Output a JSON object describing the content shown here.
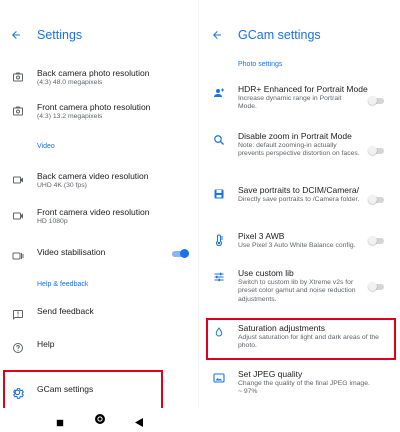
{
  "left": {
    "title": "Settings",
    "items": [
      {
        "label": "Back camera photo resolution",
        "sub": "(4:3) 48.0 megapixels",
        "icon": "photo-resolution-icon"
      },
      {
        "label": "Front camera photo resolution",
        "sub": "(4:3) 13.2 megapixels",
        "icon": "photo-resolution-icon"
      },
      {
        "label": "Back camera video resolution",
        "sub": "UHD 4K (30 fps)",
        "icon": "video-resolution-icon"
      },
      {
        "label": "Front camera video resolution",
        "sub": "HD 1080p",
        "icon": "video-resolution-icon"
      },
      {
        "label": "Video stabilisation",
        "sub": "",
        "icon": "stabilisation-icon"
      },
      {
        "label": "Send feedback",
        "sub": "",
        "icon": "feedback-icon"
      },
      {
        "label": "Help",
        "sub": "",
        "icon": "help-icon"
      },
      {
        "label": "GCam settings",
        "sub": "",
        "icon": "gcam-settings-icon"
      }
    ],
    "sections": {
      "video": "Video",
      "help": "Help & feedback"
    },
    "video_stabilisation_on": true
  },
  "right": {
    "title": "GCam settings",
    "section": "Photo settings",
    "items": [
      {
        "label": "HDR+ Enhanced for Portrait Mode",
        "sub": "Increase dynamic range in Portrait Mode.",
        "icon": "hdr-portrait-icon",
        "toggle": "off"
      },
      {
        "label": "Disable zoom in Portrait Mode",
        "sub": "Note: default zooming-in actually prevents perspective distortion on faces.",
        "icon": "zoom-icon",
        "toggle": "off"
      },
      {
        "label": "Save portraits to DCIM/Camera/",
        "sub": "Directly save portraits to /Camera folder.",
        "icon": "save-folder-icon",
        "toggle": "off"
      },
      {
        "label": "Pixel 3 AWB",
        "sub": "Use Pixel 3 Auto White Balance config.",
        "icon": "thermometer-icon",
        "toggle": "off"
      },
      {
        "label": "Use custom lib",
        "sub": "Switch to custom lib by Xtreme v2s for preset color gamut and noise reduction adjustments.",
        "icon": "sliders-icon",
        "toggle": "off"
      },
      {
        "label": "Saturation adjustments",
        "sub": "Adjust saturation for light and dark areas of the photo.",
        "icon": "drop-icon",
        "toggle": ""
      },
      {
        "label": "Set JPEG quality",
        "sub": "Change the quality of the final JPEG image.",
        "value": "~ 97%",
        "icon": "jpeg-quality-icon",
        "toggle": ""
      }
    ]
  },
  "colors": {
    "accent": "#1a73e8",
    "highlight": "#e0001b"
  }
}
